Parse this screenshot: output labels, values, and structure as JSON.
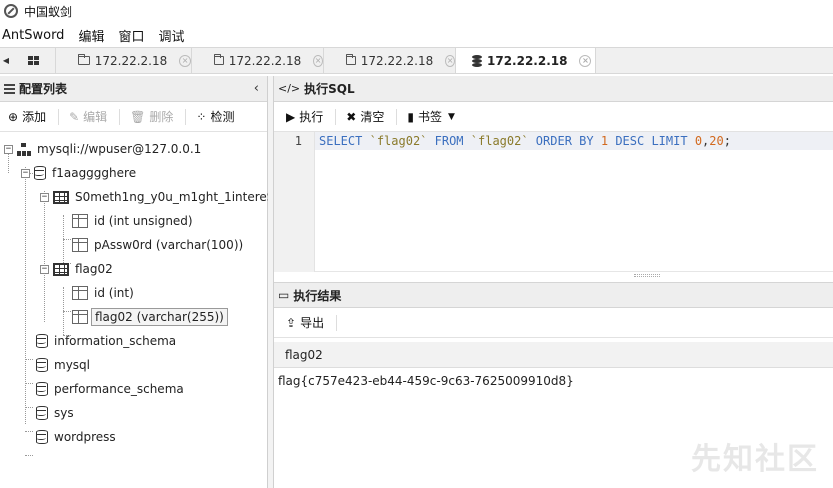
{
  "window": {
    "title": "中国蚁剑"
  },
  "menubar": {
    "items": [
      "AntSword",
      "编辑",
      "窗口",
      "调试"
    ]
  },
  "tabs": [
    {
      "label": "172.22.2.18",
      "icon": "folder-icon",
      "active": false
    },
    {
      "label": "172.22.2.18",
      "icon": "folder-icon",
      "active": false
    },
    {
      "label": "172.22.2.18",
      "icon": "folder-icon",
      "active": false
    },
    {
      "label": "172.22.2.18",
      "icon": "database-icon",
      "active": true
    }
  ],
  "left_panel": {
    "title": "配置列表",
    "toolbar": {
      "add": "添加",
      "edit": "编辑",
      "delete": "删除",
      "test": "检测"
    },
    "tree": {
      "connection": "mysqli://wpuser@127.0.0.1",
      "db1": "f1aagggghere",
      "table1": "S0meth1ng_y0u_m1ght_1intereS",
      "t1_col1": "id (int unsigned)",
      "t1_col2": "pAssw0rd (varchar(100))",
      "table2": "flag02",
      "t2_col1": "id (int)",
      "t2_col2": "flag02 (varchar(255))",
      "db2": "information_schema",
      "db3": "mysql",
      "db4": "performance_schema",
      "db5": "sys",
      "db6": "wordpress"
    }
  },
  "sql_panel": {
    "title": "执行SQL",
    "toolbar": {
      "run": "执行",
      "clear": "清空",
      "bookmark": "书签"
    },
    "line_number": "1",
    "query": "SELECT `flag02` FROM `flag02` ORDER BY 1 DESC LIMIT 0,20;"
  },
  "result_panel": {
    "title": "执行结果",
    "export": "导出",
    "column": "flag02",
    "rows": [
      "flag{c757e423-eb44-459c-9c63-7625009910d8}"
    ]
  },
  "watermark": "先知社区"
}
